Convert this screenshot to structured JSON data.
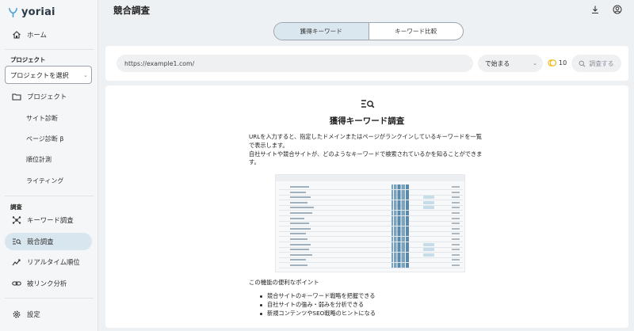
{
  "app": {
    "logo_text": "yoriai",
    "page_title": "競合調査"
  },
  "sidebar": {
    "home": "ホーム",
    "project_section": "プロジェクト",
    "project_select_placeholder": "プロジェクトを選択",
    "project": "プロジェクト",
    "sub_items": [
      "サイト診断",
      "ページ診断 β",
      "順位計測",
      "ライティング"
    ],
    "research_section": "調査",
    "items": [
      "キーワード調査",
      "競合調査",
      "リアルタイム順位",
      "被リンク分析"
    ],
    "settings": "設定"
  },
  "tabs": [
    {
      "label": "獲得キーワード",
      "active": true
    },
    {
      "label": "キーワード比較",
      "active": false
    }
  ],
  "search": {
    "url_value": "https://example1.com/",
    "match_mode": "で始まる",
    "credits": "10",
    "button_label": "調査する"
  },
  "feature": {
    "title": "獲得キーワード調査",
    "description": "URLを入力すると、指定したドメインまたはページがランクインしているキーワードを一覧で表示します。\n自社サイトや競合サイトが、どのようなキーワードで検索されているかを知ることができます。",
    "points_title": "この機能の便利なポイント",
    "points": [
      "競合サイトのキーワード戦略を把握できる",
      "自社サイトの強み・弱みを分析できる",
      "新規コンテンツやSEO戦略のヒントになる"
    ]
  },
  "colors": {
    "accent": "#dbe7ef",
    "coin": "#f0b400"
  }
}
